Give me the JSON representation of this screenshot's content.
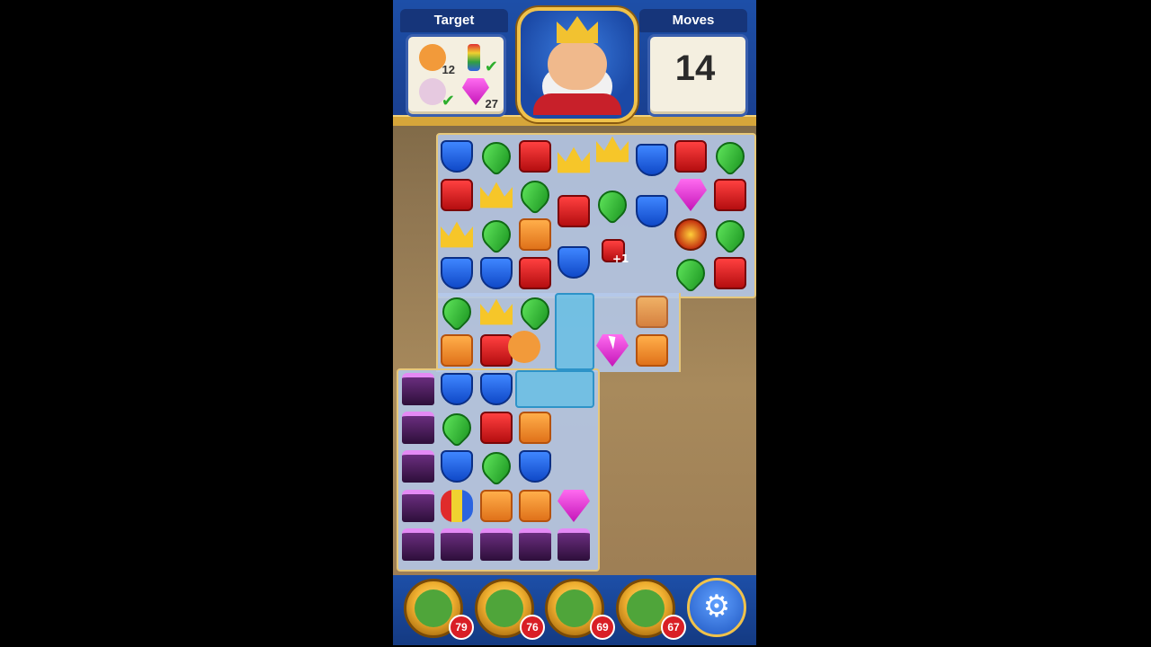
{
  "hud": {
    "target_label": "Target",
    "moves_label": "Moves",
    "moves_value": "14",
    "targets": [
      {
        "icon": "teddy-bear-icon",
        "count": "12"
      },
      {
        "icon": "rocket-icon",
        "done": "✔"
      },
      {
        "icon": "egg-icon",
        "done": "✔"
      },
      {
        "icon": "gem-icon",
        "count": "27"
      }
    ]
  },
  "board": {
    "effect_text": "+1"
  },
  "boosters": [
    {
      "name": "hammer-booster",
      "count": "79"
    },
    {
      "name": "arrow-booster",
      "count": "76"
    },
    {
      "name": "cannon-booster",
      "count": "69"
    },
    {
      "name": "jester-hat-booster",
      "count": "67"
    }
  ],
  "settings": {
    "icon": "⚙"
  },
  "colors": {
    "hud_blue": "#1d4fa8",
    "gold": "#f0c24b",
    "badge_red": "#d91f26"
  }
}
